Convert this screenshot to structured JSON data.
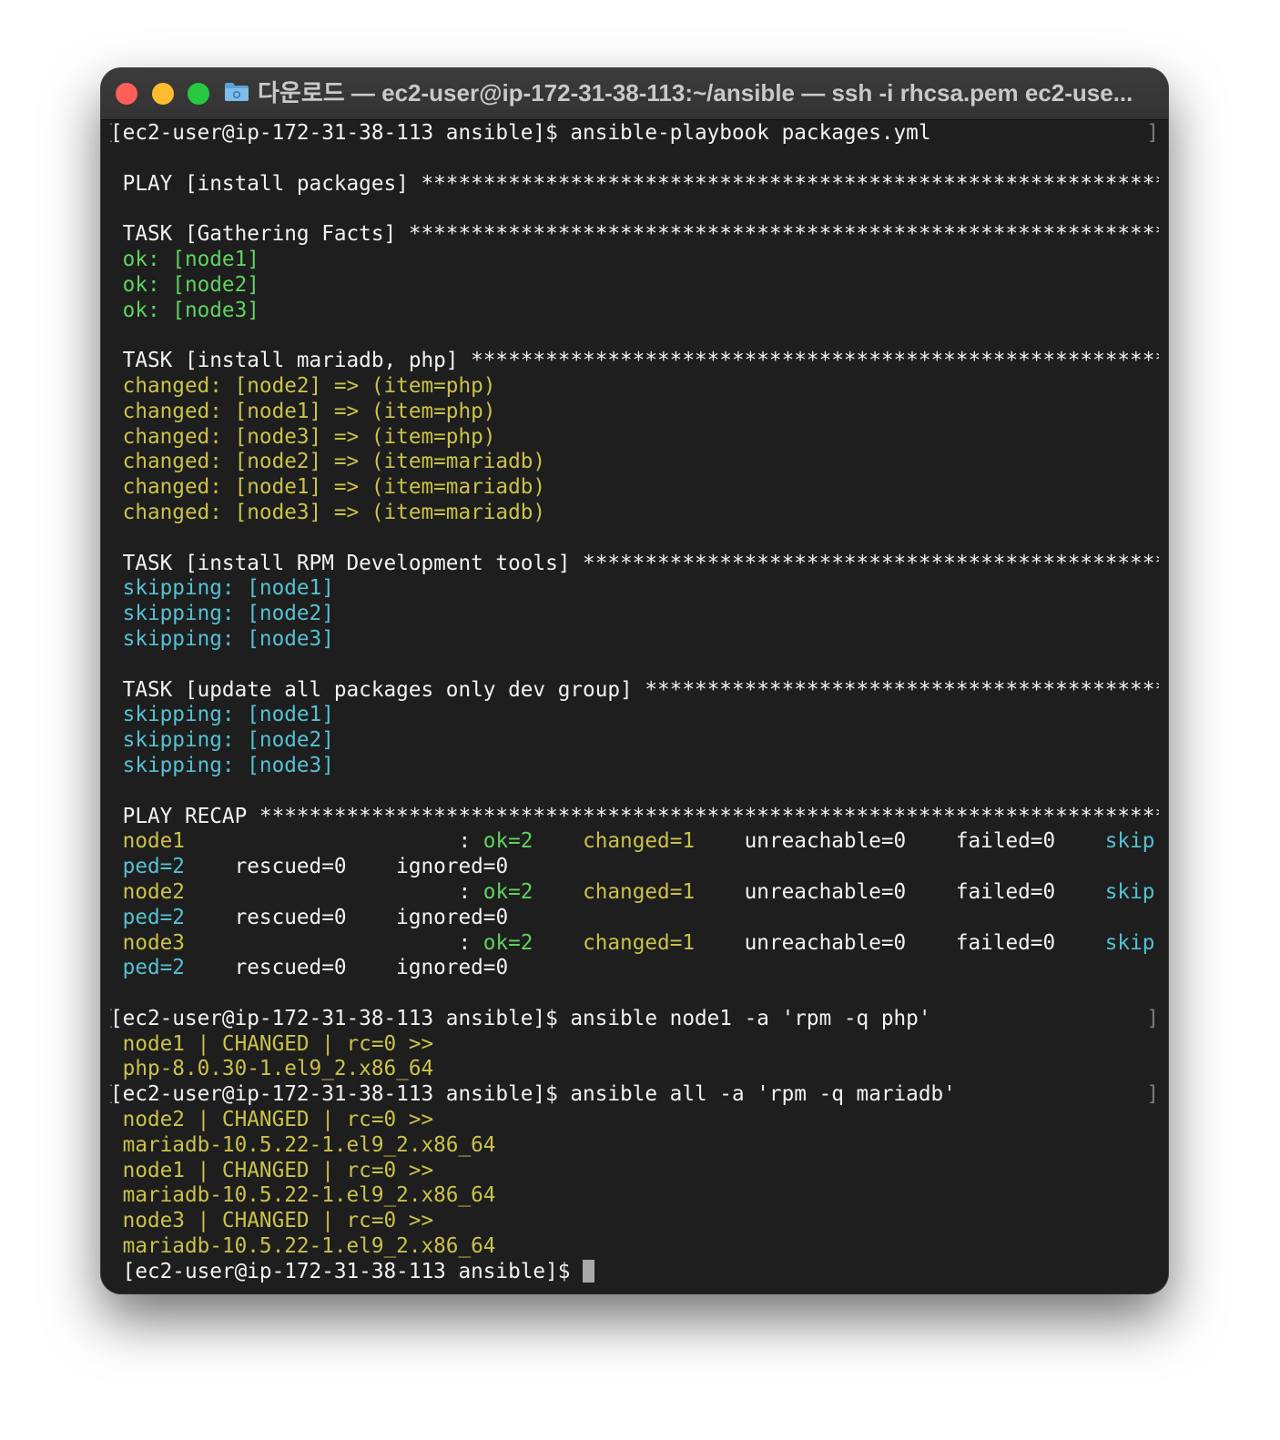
{
  "window": {
    "title": "다운로드 — ec2-user@ip-172-31-38-113:~/ansible — ssh -i rhcsa.pem ec2-use...",
    "folder_icon": "folder-icon"
  },
  "colors": {
    "ok": "#5fd35f",
    "changed": "#cbc24a",
    "skipping": "#55c1d3",
    "text": "#f2f2f2",
    "background": "#1e1e1e"
  },
  "terminal": {
    "lines": [
      {
        "segments": [
          {
            "t": "[ec2-user@ip-172-31-38-113 ansible]$ ansible-playbook packages.yml",
            "c": "w"
          }
        ],
        "marks": true
      },
      {
        "segments": []
      },
      {
        "segments": [
          {
            "t": " PLAY [install packages] ************************************************************",
            "c": "w"
          }
        ]
      },
      {
        "segments": []
      },
      {
        "segments": [
          {
            "t": " TASK [Gathering Facts] *************************************************************",
            "c": "w"
          }
        ]
      },
      {
        "segments": [
          {
            "t": " ok: [node1]",
            "c": "g"
          }
        ]
      },
      {
        "segments": [
          {
            "t": " ok: [node2]",
            "c": "g"
          }
        ]
      },
      {
        "segments": [
          {
            "t": " ok: [node3]",
            "c": "g"
          }
        ]
      },
      {
        "segments": []
      },
      {
        "segments": [
          {
            "t": " TASK [install mariadb, php] ********************************************************",
            "c": "w"
          }
        ]
      },
      {
        "segments": [
          {
            "t": " changed: [node2] => (item=php)",
            "c": "y"
          }
        ]
      },
      {
        "segments": [
          {
            "t": " changed: [node1] => (item=php)",
            "c": "y"
          }
        ]
      },
      {
        "segments": [
          {
            "t": " changed: [node3] => (item=php)",
            "c": "y"
          }
        ]
      },
      {
        "segments": [
          {
            "t": " changed: [node2] => (item=mariadb)",
            "c": "y"
          }
        ]
      },
      {
        "segments": [
          {
            "t": " changed: [node1] => (item=mariadb)",
            "c": "y"
          }
        ]
      },
      {
        "segments": [
          {
            "t": " changed: [node3] => (item=mariadb)",
            "c": "y"
          }
        ]
      },
      {
        "segments": []
      },
      {
        "segments": [
          {
            "t": " TASK [install RPM Development tools] ***********************************************",
            "c": "w"
          }
        ]
      },
      {
        "segments": [
          {
            "t": " skipping: [node1]",
            "c": "c"
          }
        ]
      },
      {
        "segments": [
          {
            "t": " skipping: [node2]",
            "c": "c"
          }
        ]
      },
      {
        "segments": [
          {
            "t": " skipping: [node3]",
            "c": "c"
          }
        ]
      },
      {
        "segments": []
      },
      {
        "segments": [
          {
            "t": " TASK [update all packages only dev group] ******************************************",
            "c": "w"
          }
        ]
      },
      {
        "segments": [
          {
            "t": " skipping: [node1]",
            "c": "c"
          }
        ]
      },
      {
        "segments": [
          {
            "t": " skipping: [node2]",
            "c": "c"
          }
        ]
      },
      {
        "segments": [
          {
            "t": " skipping: [node3]",
            "c": "c"
          }
        ]
      },
      {
        "segments": []
      },
      {
        "segments": [
          {
            "t": " PLAY RECAP *************************************************************************",
            "c": "w"
          }
        ]
      },
      {
        "segments": [
          {
            "t": " node1",
            "c": "y"
          },
          {
            "t": "                      : ",
            "c": "w"
          },
          {
            "t": "ok=2",
            "c": "g"
          },
          {
            "t": "    ",
            "c": "w"
          },
          {
            "t": "changed=1",
            "c": "y"
          },
          {
            "t": "    unreachable=0    failed=0    ",
            "c": "w"
          },
          {
            "t": "skip",
            "c": "c"
          }
        ]
      },
      {
        "segments": [
          {
            "t": " ped=2",
            "c": "c"
          },
          {
            "t": "    rescued=0    ignored=0",
            "c": "w"
          }
        ]
      },
      {
        "segments": [
          {
            "t": " node2",
            "c": "y"
          },
          {
            "t": "                      : ",
            "c": "w"
          },
          {
            "t": "ok=2",
            "c": "g"
          },
          {
            "t": "    ",
            "c": "w"
          },
          {
            "t": "changed=1",
            "c": "y"
          },
          {
            "t": "    unreachable=0    failed=0    ",
            "c": "w"
          },
          {
            "t": "skip",
            "c": "c"
          }
        ]
      },
      {
        "segments": [
          {
            "t": " ped=2",
            "c": "c"
          },
          {
            "t": "    rescued=0    ignored=0",
            "c": "w"
          }
        ]
      },
      {
        "segments": [
          {
            "t": " node3",
            "c": "y"
          },
          {
            "t": "                      : ",
            "c": "w"
          },
          {
            "t": "ok=2",
            "c": "g"
          },
          {
            "t": "    ",
            "c": "w"
          },
          {
            "t": "changed=1",
            "c": "y"
          },
          {
            "t": "    unreachable=0    failed=0    ",
            "c": "w"
          },
          {
            "t": "skip",
            "c": "c"
          }
        ]
      },
      {
        "segments": [
          {
            "t": " ped=2",
            "c": "c"
          },
          {
            "t": "    rescued=0    ignored=0",
            "c": "w"
          }
        ]
      },
      {
        "segments": []
      },
      {
        "segments": [
          {
            "t": "[ec2-user@ip-172-31-38-113 ansible]$ ansible node1 -a 'rpm -q php'",
            "c": "w"
          }
        ],
        "marks": true
      },
      {
        "segments": [
          {
            "t": " node1 | CHANGED | rc=0 >>",
            "c": "y"
          }
        ]
      },
      {
        "segments": [
          {
            "t": " php-8.0.30-1.el9_2.x86_64",
            "c": "y"
          }
        ]
      },
      {
        "segments": [
          {
            "t": "[ec2-user@ip-172-31-38-113 ansible]$ ansible all -a 'rpm -q mariadb'",
            "c": "w"
          }
        ],
        "marks": true
      },
      {
        "segments": [
          {
            "t": " node2 | CHANGED | rc=0 >>",
            "c": "y"
          }
        ]
      },
      {
        "segments": [
          {
            "t": " mariadb-10.5.22-1.el9_2.x86_64",
            "c": "y"
          }
        ]
      },
      {
        "segments": [
          {
            "t": " node1 | CHANGED | rc=0 >>",
            "c": "y"
          }
        ]
      },
      {
        "segments": [
          {
            "t": " mariadb-10.5.22-1.el9_2.x86_64",
            "c": "y"
          }
        ]
      },
      {
        "segments": [
          {
            "t": " node3 | CHANGED | rc=0 >>",
            "c": "y"
          }
        ]
      },
      {
        "segments": [
          {
            "t": " mariadb-10.5.22-1.el9_2.x86_64",
            "c": "y"
          }
        ]
      },
      {
        "segments": [
          {
            "t": " [ec2-user@ip-172-31-38-113 ansible]$ ",
            "c": "w"
          }
        ],
        "cursor": true
      }
    ],
    "mark_left": "[",
    "mark_right": "]"
  }
}
